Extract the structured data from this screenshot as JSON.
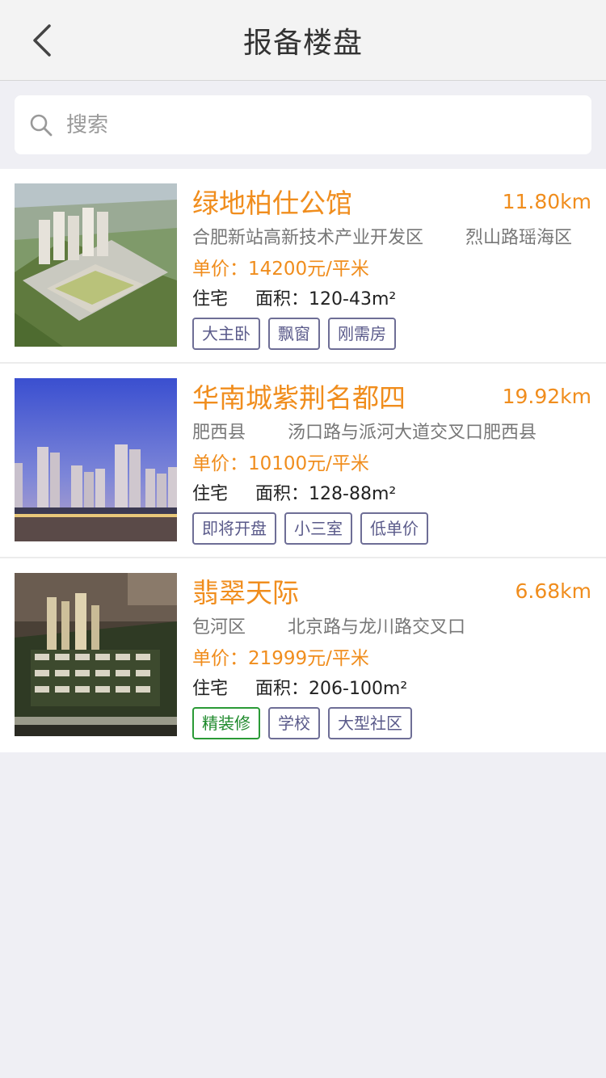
{
  "header": {
    "title": "报备楼盘"
  },
  "search": {
    "placeholder": "搜索"
  },
  "properties": [
    {
      "name": "绿地柏仕公馆",
      "distance": "11.80km",
      "district": "合肥新站高新技术产业开发区",
      "road": "烈山路瑶海区",
      "price": "单价：14200元/平米",
      "type": "住宅",
      "area": "面积：120-43m²",
      "tags": [
        "大主卧",
        "飘窗",
        "刚需房"
      ]
    },
    {
      "name": "华南城紫荆名都四",
      "distance": "19.92km",
      "district": "肥西县",
      "road": "汤口路与派河大道交叉口肥西县",
      "price": "单价：10100元/平米",
      "type": "住宅",
      "area": "面积：128-88m²",
      "tags": [
        "即将开盘",
        "小三室",
        "低单价"
      ]
    },
    {
      "name": "翡翠天际",
      "distance": "6.68km",
      "district": "包河区",
      "road": "北京路与龙川路交叉口",
      "price": "单价：21999元/平米",
      "type": "住宅",
      "area": "面积：206-100m²",
      "tags": [
        "精装修",
        "学校",
        "大型社区"
      ]
    }
  ],
  "colors": {
    "accent": "#f08d1d",
    "tag_border": "#6e6e96",
    "tag_green": "#2a9a36",
    "background": "#efeff4"
  }
}
